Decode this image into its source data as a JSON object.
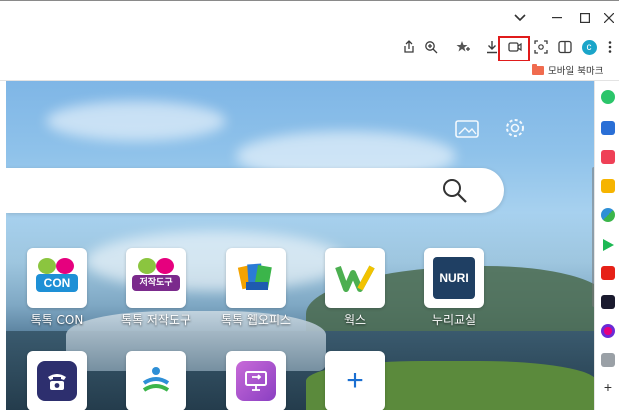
{
  "titlebar": {
    "controls": [
      "chevron-down",
      "minimize",
      "maximize",
      "close"
    ]
  },
  "toolbar": {
    "icons": [
      "share-icon",
      "zoom-icon",
      "favorites-icon",
      "download-icon",
      "record-icon",
      "screenshot-icon",
      "split-view-icon",
      "profile-icon",
      "menu-icon"
    ],
    "profile_initial": "c",
    "accent": "#1ba5c9",
    "highlight_color": "#e01b1b"
  },
  "bookmarks": {
    "mobile_label": "모바일 북마크"
  },
  "newtab": {
    "tiles_row1": [
      {
        "label": "톡톡 CON"
      },
      {
        "label": "톡톡 저작도구"
      },
      {
        "label": "톡톡 웹오피스"
      },
      {
        "label": "웍스"
      },
      {
        "label": "누리교실"
      }
    ],
    "con_badge": "CON",
    "tool_badge": "저작도구",
    "nuri_badge": "NURI",
    "add_symbol": "+"
  },
  "sidebar": {
    "add_symbol": "+",
    "icons": [
      "chat-icon",
      "wallet-icon",
      "pocket-icon",
      "star-icon",
      "translate-icon",
      "play-icon",
      "youtube-icon",
      "notion-icon",
      "flower-icon",
      "text-icon"
    ]
  }
}
